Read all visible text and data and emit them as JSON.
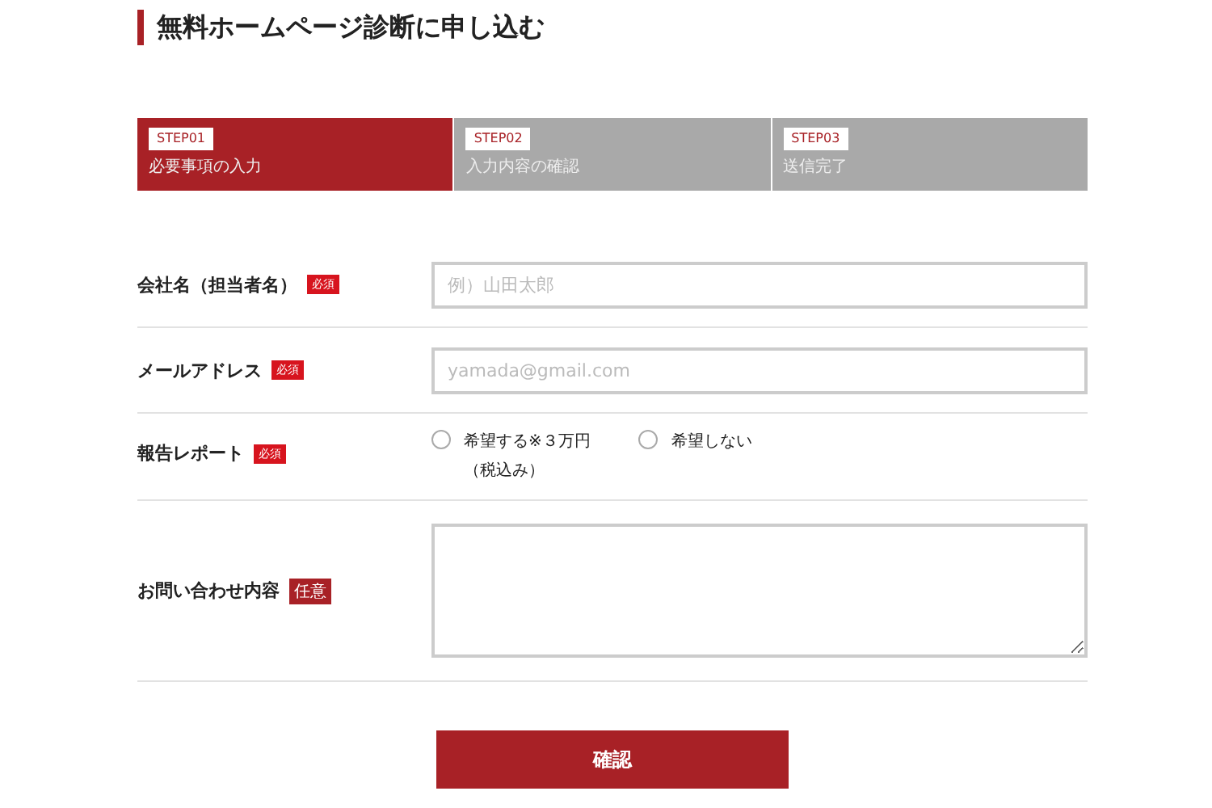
{
  "title": "無料ホームページ診断に申し込む",
  "steps": [
    {
      "badge": "STEP01",
      "label": "必要事項の入力",
      "selected": true
    },
    {
      "badge": "STEP02",
      "label": "入力内容の確認",
      "selected": false
    },
    {
      "badge": "STEP03",
      "label": "送信完了",
      "selected": false
    }
  ],
  "fields": [
    {
      "kind": "text",
      "label": "会社名（担当者名）",
      "badge": "必須",
      "required": true,
      "placeholder": "例）山田太郎"
    },
    {
      "kind": "text",
      "label": "メールアドレス",
      "badge": "必須",
      "required": true,
      "placeholder": "yamada@gmail.com"
    },
    {
      "kind": "radio",
      "label": "報告レポート",
      "badge": "必須",
      "required": true,
      "options": [
        {
          "label": "希望する※３万円",
          "note": "（税込み）",
          "selected": false
        },
        {
          "label": "希望しない",
          "selected": false
        }
      ]
    },
    {
      "kind": "textarea",
      "label": "お問い合わせ内容",
      "badge": "任意",
      "required": false
    }
  ],
  "submit": "確認"
}
